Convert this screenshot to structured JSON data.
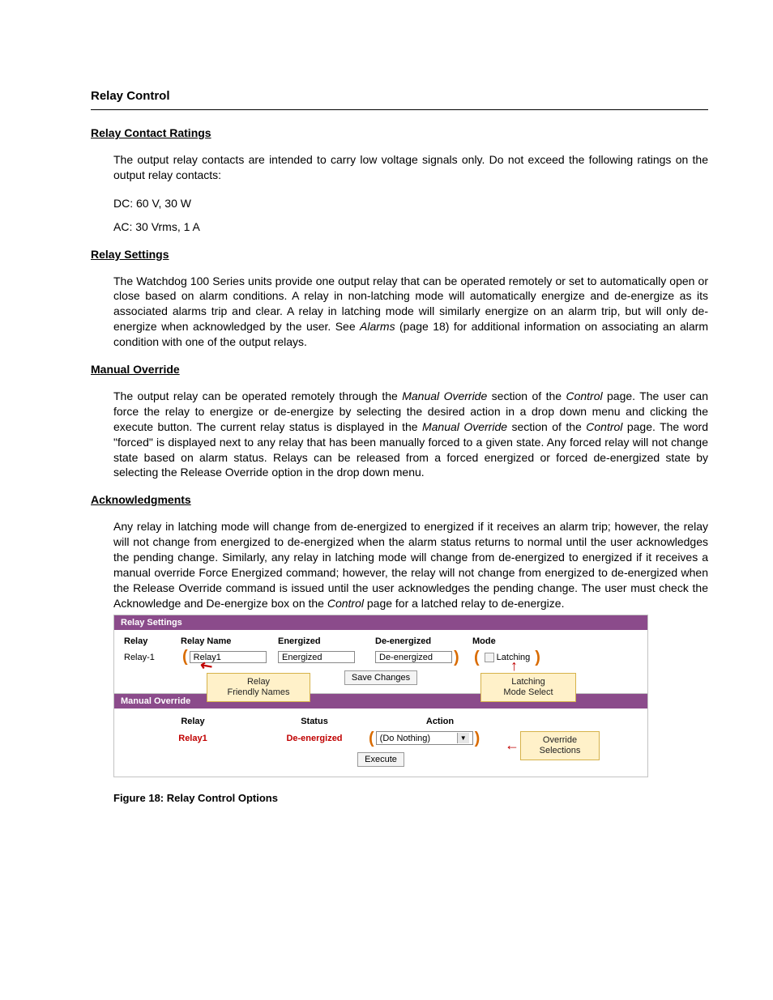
{
  "title": "Relay Control",
  "sections": {
    "ratings": {
      "heading": "Relay Contact Ratings",
      "p1": "The output relay contacts are intended to carry low voltage signals only.  Do not exceed the following ratings on the output relay contacts:",
      "dc": "DC: 60 V, 30 W",
      "ac": "AC: 30 Vrms, 1 A"
    },
    "settings": {
      "heading": "Relay Settings",
      "p1_a": "The Watchdog 100 Series units provide one output relay that can be operated remotely or set to automatically open or close based on alarm conditions.  A relay in non-latching mode will automatically energize and de-energize as its associated alarms trip and clear.  A relay in latching mode will similarly energize on an alarm trip, but will only de-energize when acknowledged by the user.  See ",
      "p1_it": "Alarms",
      "p1_b": " (page 18) for additional information on associating an alarm condition with one of the output relays."
    },
    "manual": {
      "heading": "Manual Override",
      "p1_a": "The output relay can be operated remotely through the ",
      "p1_it1": "Manual Override",
      "p1_b": " section of the ",
      "p1_it2": "Control",
      "p1_c": " page.  The user can force the relay to energize or de-energize by selecting the desired action in a drop down menu and clicking the execute button.  The current relay status is displayed in the ",
      "p1_it3": "Manual Override",
      "p1_d": " section of the ",
      "p1_it4": "Control",
      "p1_e": " page.  The word \"forced\" is displayed next to any relay that has been manually forced to a given state.  Any forced relay will not change state based on alarm status.  Relays can be released from a forced energized or forced de-energized state by selecting the Release Override option in the drop down menu."
    },
    "ack": {
      "heading": "Acknowledgments",
      "p1_a": "Any relay in latching mode will change from de-energized to energized if it receives an alarm trip; however, the relay will not change from energized to de-energized when the alarm status returns to normal until the user acknowledges the pending change.  Similarly, any relay in latching mode will change from de-energized to energized if it receives a manual override Force Energized command; however, the relay will not change from energized to de-energized when the Release Override command is issued until the user acknowledges the pending change. The user must check the Acknowledge and De-energize box on the ",
      "p1_it": "Control",
      "p1_b": " page for a latched relay to de-energize."
    }
  },
  "figure": {
    "caption": "Figure 18: Relay Control Options",
    "relay_settings": {
      "panel_title": "Relay Settings",
      "head": {
        "relay": "Relay",
        "name": "Relay Name",
        "en": "Energized",
        "de": "De-energized",
        "mode": "Mode"
      },
      "row": {
        "relay": "Relay-1",
        "name": "Relay1",
        "en": "Energized",
        "de": "De-energized",
        "latch_label": "Latching"
      },
      "save_btn": "Save Changes"
    },
    "manual_override": {
      "panel_title": "Manual Override",
      "head": {
        "relay": "Relay",
        "status": "Status",
        "action": "Action"
      },
      "row": {
        "relay": "Relay1",
        "status": "De-energized",
        "action": "(Do Nothing)"
      },
      "exec_btn": "Execute"
    },
    "callouts": {
      "friendly": "Relay\nFriendly Names",
      "latching": "Latching\nMode Select",
      "override": "Override\nSelections"
    }
  }
}
